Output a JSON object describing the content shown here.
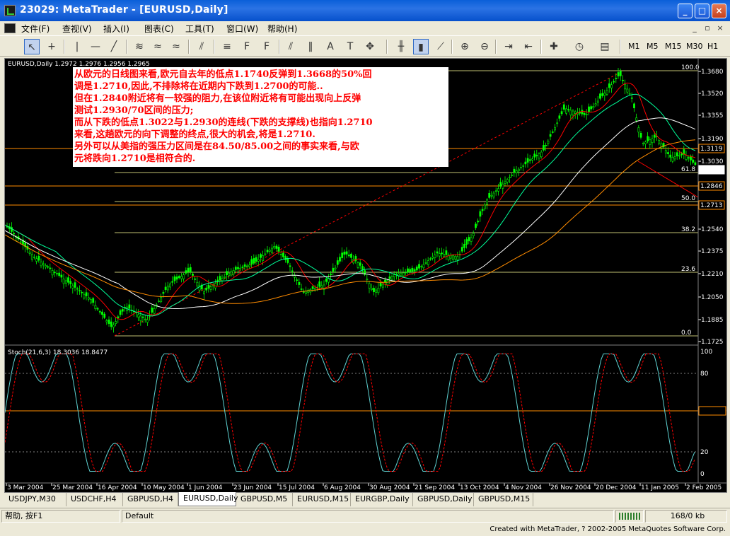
{
  "window": {
    "title": "23029: MetaTrader - [EURUSD,Daily]"
  },
  "menu": [
    "文件(F)",
    "查视(V)",
    "插入(I)",
    "图表(C)",
    "工具(T)",
    "窗口(W)",
    "帮助(H)"
  ],
  "timeframes": [
    "M1",
    "M5",
    "M15",
    "M30",
    "H1"
  ],
  "chart": {
    "header": "EURUSD,Daily  1.2972 1.2976 1.2956 1.2965",
    "indicator_header": "Stoch(21,6,3) 18.3036 18.8477",
    "price_axis": [
      "1.3680",
      "1.3520",
      "1.3355",
      "1.3190",
      "1.3030",
      "1.2865",
      "1.2700",
      "1.2540",
      "1.2375",
      "1.2210",
      "1.2050",
      "1.1885",
      "1.1725"
    ],
    "price_tags": [
      {
        "label": "1.3119",
        "color": "#ff8c00"
      },
      {
        "label": "1.2965",
        "color": "#ffffff"
      },
      {
        "label": "1.2846",
        "color": "#ff8c00"
      },
      {
        "label": "1.2713",
        "color": "#ff8c00"
      }
    ],
    "fibo_levels": [
      "100.0",
      "61.8",
      "50.0",
      "38.2",
      "23.6",
      "0.0"
    ],
    "stoch_axis": [
      "100",
      "80",
      "50.0000",
      "20",
      "0"
    ],
    "date_axis": [
      "3 Mar 2004",
      "25 Mar 2004",
      "16 Apr 2004",
      "10 May 2004",
      "1 Jun 2004",
      "23 Jun 2004",
      "15 Jul 2004",
      "6 Aug 2004",
      "30 Aug 2004",
      "21 Sep 2004",
      "13 Oct 2004",
      "4 Nov 2004",
      "26 Nov 2004",
      "20 Dec 2004",
      "11 Jan 2005",
      "2 Feb 2005"
    ],
    "annotation": [
      "从欧元的日线图来看,欧元自去年的低点1.1740反弹到1.3668的50%回",
      "调是1.2710,因此,不排除将在近期内下跌到1.2700的可能..",
      "但在1.2840附近将有一较强的阻力,在该位附近将有可能出现向上反弹",
      "测试1.2930/70区间的压力;",
      "而从下跌的低点1.3022与1.2930的连线(下跌的支撑线)也指向1.2710",
      "来看,这趟欧元的向下调整的终点,很大的机会,将是1.2710.",
      "另外可以从美指的强压力区间是在84.50/85.00之间的事实来看,与欧",
      "元将跌向1.2710是相符合的."
    ]
  },
  "tabs": [
    "USDJPY,M30",
    "USDCHF,H4",
    "GBPUSD,H4",
    "EURUSD,Daily",
    "GBPUSD,M5",
    "EURUSD,M15",
    "EURGBP,Daily",
    "GBPUSD,Daily",
    "GBPUSD,M15"
  ],
  "active_tab": "EURUSD,Daily",
  "status": {
    "help": "帮助, 按F1",
    "profile": "Default",
    "traffic": "168/0 kb"
  },
  "credit": "Created with MetaTrader, ? 2002-2005 MetaQuotes Software Corp."
}
